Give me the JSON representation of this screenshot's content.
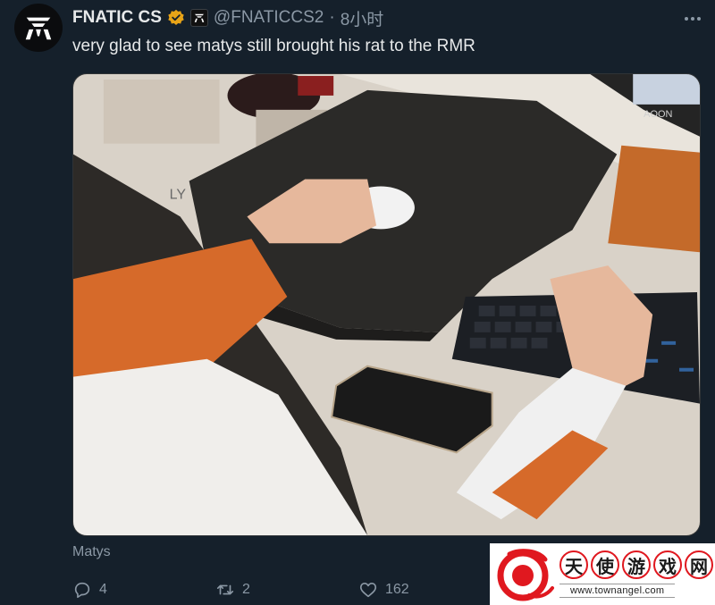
{
  "author": {
    "display_name": "FNATIC CS",
    "handle": "@FNATICCS2",
    "separator": "·",
    "time": "8小时",
    "verified_color": "#e8a417",
    "avatar_icon": "fnatic-logo-icon",
    "affiliate_icon": "fnatic-affiliate-badge-icon"
  },
  "tweet": {
    "text": "very glad to see matys still brought his rat to the RMR"
  },
  "media": {
    "description_icon": "photo-image",
    "overlay_text": "AOON",
    "mousepad_brand": "LY"
  },
  "caption": "Matys",
  "actions": {
    "replies": "4",
    "retweets": "2",
    "likes": "162"
  },
  "watermark": {
    "chars": [
      "天",
      "使",
      "游",
      "戏",
      "网"
    ],
    "url": "www.townangel.com",
    "brand_color": "#e0181f"
  }
}
